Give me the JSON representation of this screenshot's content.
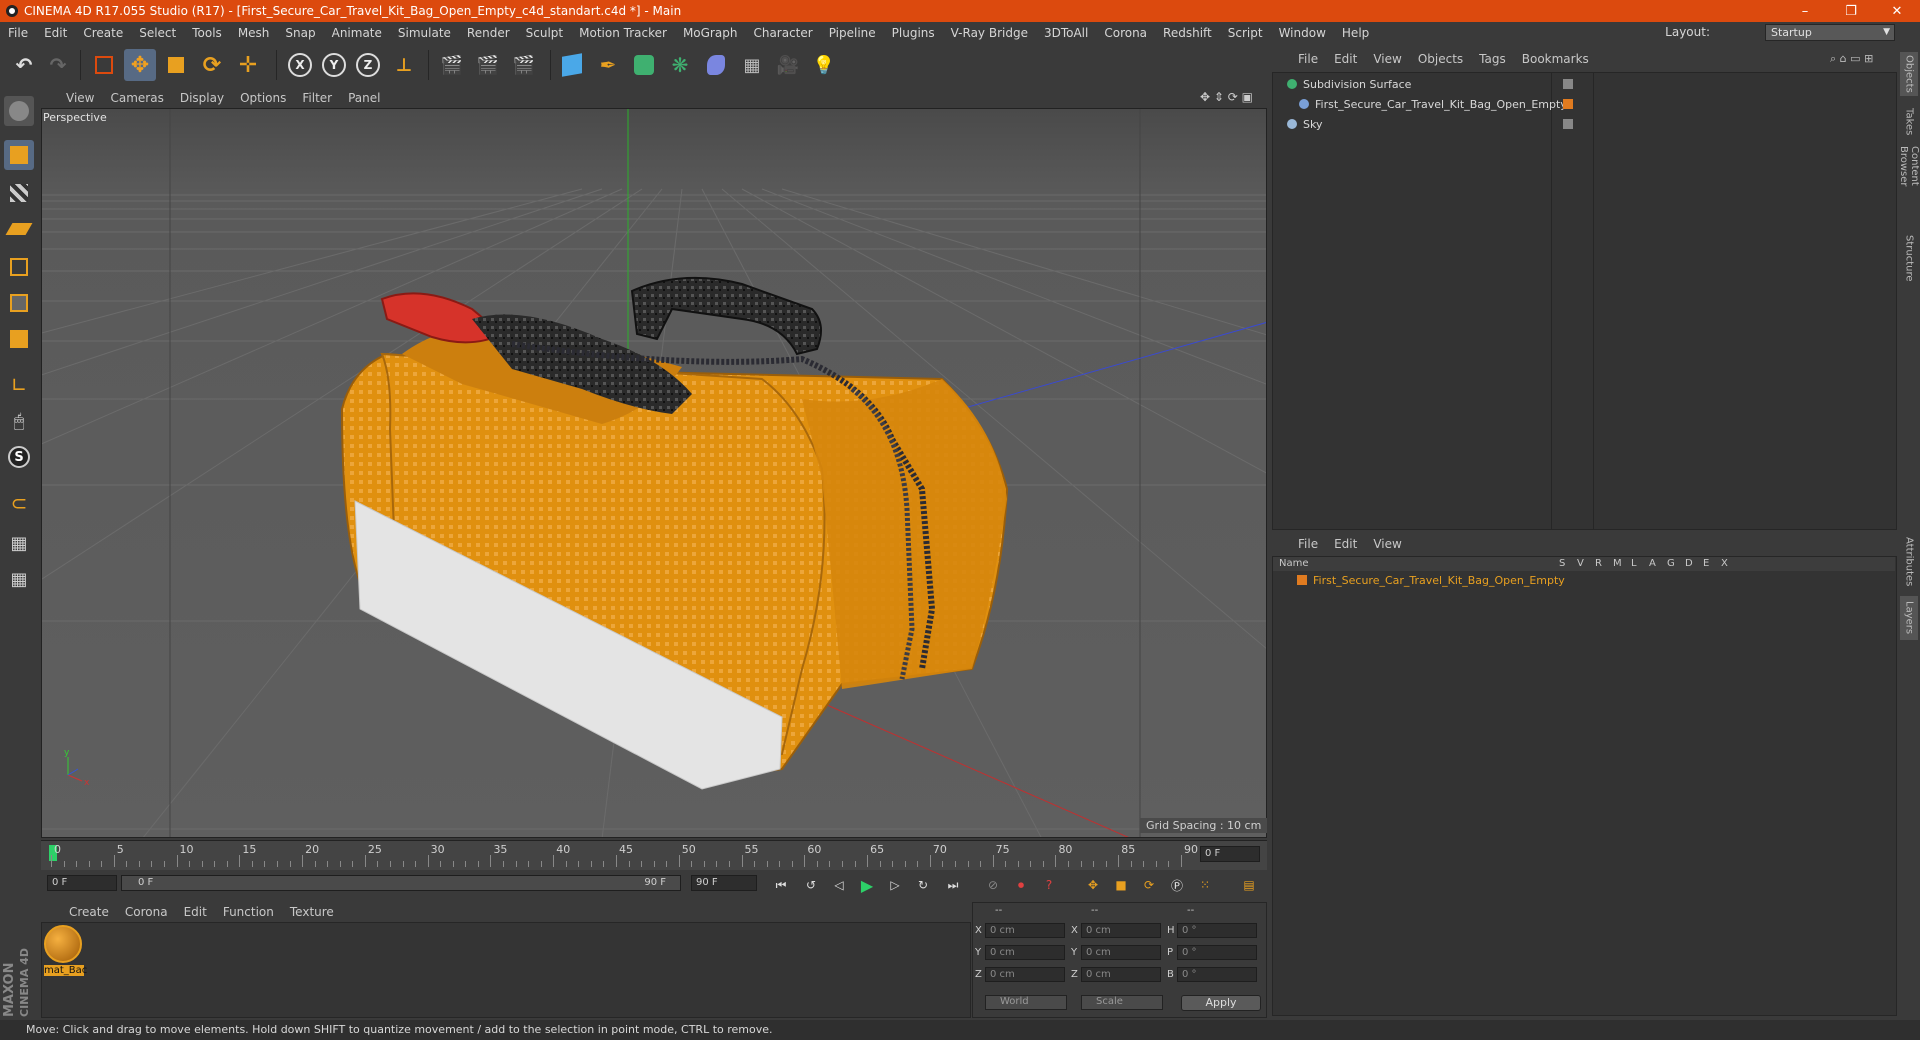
{
  "title_bar": {
    "title": "CINEMA 4D R17.055 Studio (R17) - [First_Secure_Car_Travel_Kit_Bag_Open_Empty_c4d_standart.c4d *] - Main",
    "minimize": "–",
    "restore": "❐",
    "close": "✕"
  },
  "menu": [
    "File",
    "Edit",
    "Create",
    "Select",
    "Tools",
    "Mesh",
    "Snap",
    "Animate",
    "Simulate",
    "Render",
    "Sculpt",
    "Motion Tracker",
    "MoGraph",
    "Character",
    "Pipeline",
    "Plugins",
    "V-Ray Bridge",
    "3DToAll",
    "Corona",
    "Redshift",
    "Script",
    "Window",
    "Help"
  ],
  "layout": {
    "label": "Layout:",
    "value": "Startup"
  },
  "viewport": {
    "menu": [
      "View",
      "Cameras",
      "Display",
      "Options",
      "Filter",
      "Panel"
    ],
    "camera_label": "Perspective",
    "grid_spacing": "Grid Spacing : 10 cm"
  },
  "timeline": {
    "ticks": [
      "0",
      "5",
      "10",
      "15",
      "20",
      "25",
      "30",
      "35",
      "40",
      "45",
      "50",
      "55",
      "60",
      "65",
      "70",
      "75",
      "80",
      "85",
      "90"
    ],
    "current_frame": "0 F",
    "start_field": "0 F",
    "range_start": "0 F",
    "range_end": "90 F",
    "end_field": "90 F"
  },
  "material_manager": {
    "menu": [
      "Create",
      "Corona",
      "Edit",
      "Function",
      "Texture"
    ],
    "materials": [
      {
        "name": "mat_Bac"
      }
    ]
  },
  "coordinates": {
    "headers": [
      "--",
      "--",
      "--"
    ],
    "rows": [
      {
        "a": "X",
        "a_val": "0 cm",
        "b": "X",
        "b_val": "0 cm",
        "c": "H",
        "c_val": "0 °"
      },
      {
        "a": "Y",
        "a_val": "0 cm",
        "b": "Y",
        "b_val": "0 cm",
        "c": "P",
        "c_val": "0 °"
      },
      {
        "a": "Z",
        "a_val": "0 cm",
        "b": "Z",
        "b_val": "0 cm",
        "c": "B",
        "c_val": "0 °"
      }
    ],
    "world": "World",
    "scale": "Scale",
    "apply": "Apply"
  },
  "object_manager": {
    "menu": [
      "File",
      "Edit",
      "View",
      "Objects",
      "Tags",
      "Bookmarks"
    ],
    "objects": [
      {
        "name": "Subdivision Surface",
        "indent": 0
      },
      {
        "name": "First_Secure_Car_Travel_Kit_Bag_Open_Empty",
        "indent": 1
      },
      {
        "name": "Sky",
        "indent": 0
      }
    ]
  },
  "layer_manager": {
    "menu": [
      "File",
      "Edit",
      "View"
    ],
    "columns": [
      "Name",
      "S",
      "V",
      "R",
      "M",
      "L",
      "A",
      "G",
      "D",
      "E",
      "X"
    ],
    "layers": [
      {
        "name": "First_Secure_Car_Travel_Kit_Bag_Open_Empty",
        "color": "#e07b20"
      }
    ]
  },
  "side_tabs": [
    "Objects",
    "Takes",
    "Content Browser",
    "Structure",
    "Attributes",
    "Layers"
  ],
  "status": "Move: Click and drag to move elements. Hold down SHIFT to quantize movement / add to the selection in point mode, CTRL to remove.",
  "brand": {
    "line1": "MAXON",
    "line2": "CINEMA 4D"
  },
  "colors": {
    "accent": "#dc4a0e",
    "bag": "#e0900f",
    "selection": "#e07b20"
  }
}
